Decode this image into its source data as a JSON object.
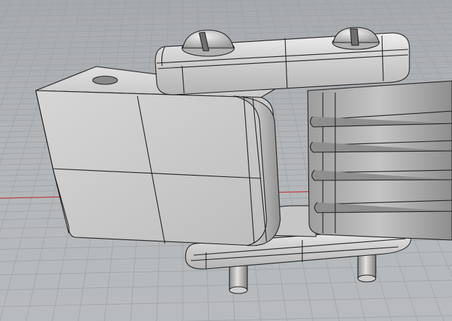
{
  "viewport": {
    "name": "Perspective",
    "background_color": "#b4b7ba",
    "grid_line_color": "#9ea2a6",
    "x_axis_color": "#c23a3a",
    "model_fill_color": "#c9cacb",
    "model_edge_color": "#1c1c1c"
  },
  "model": {
    "parts": [
      "left-block",
      "top-link-plate",
      "bottom-link-plate",
      "right-ribbed-block",
      "screw-head-left",
      "screw-head-right",
      "pin-left",
      "pin-right"
    ]
  }
}
